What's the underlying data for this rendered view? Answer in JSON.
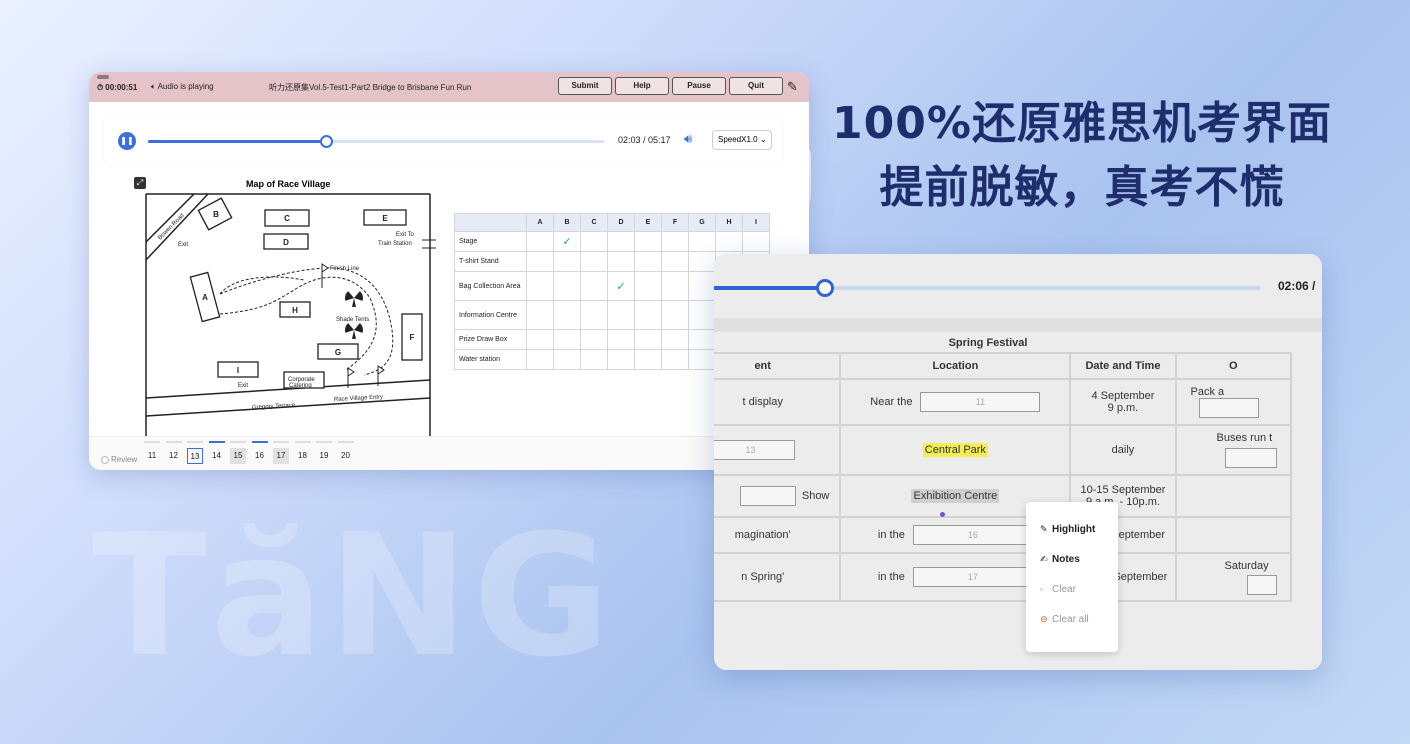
{
  "headline": {
    "line1": "100%还原雅思机考界面",
    "line2": "提前脱敏，真考不慌"
  },
  "watermark": "TăNG",
  "exam_window": {
    "timer": "00:00:51",
    "audio_status": "Audio is playing",
    "title": "听力还原集Vol.5-Test1-Part2 Bridge to Brisbane Fun Run",
    "buttons": [
      "Submit",
      "Help",
      "Pause",
      "Quit"
    ],
    "player": {
      "time": "02:03 / 05:17",
      "speed": "SpeedX1.0",
      "progress": 0.39
    },
    "map_title": "Map of Race Village",
    "map_labels": {
      "bowen_road": "Bowen Road",
      "exit_top": "Exit",
      "exit_to": "Exit To",
      "train_station": "Train Station",
      "finish_line": "Finish Line",
      "shade_tents": "Shade Tents",
      "corporate": "Corporate",
      "catering": "Catering",
      "exit_bottom": "Exit",
      "gregory": "Gregory Terrace",
      "entry": "Race Village Entry",
      "boxes": [
        "A",
        "B",
        "C",
        "D",
        "E",
        "F",
        "G",
        "H",
        "I"
      ]
    },
    "grid": {
      "columns": [
        "A",
        "B",
        "C",
        "D",
        "E",
        "F",
        "G",
        "H",
        "I"
      ],
      "rows": [
        {
          "label": "Stage",
          "check": "B"
        },
        {
          "label": "T-shirt Stand",
          "check": ""
        },
        {
          "label": "Bag Collection Area",
          "check": "D"
        },
        {
          "label": "Information Centre",
          "check": ""
        },
        {
          "label": "Prize Draw Box",
          "check": ""
        },
        {
          "label": "Water station",
          "check": ""
        }
      ]
    },
    "review_label": "Review",
    "questions": [
      "11",
      "12",
      "13",
      "14",
      "15",
      "16",
      "17",
      "18",
      "19",
      "20"
    ],
    "current_question": "13"
  },
  "festival_window": {
    "time": "02:06 /",
    "progress": 0.2,
    "caption": "Spring Festival",
    "headers": [
      "ent",
      "Location",
      "Date and Time",
      "O"
    ],
    "rows": [
      {
        "c1": "t display",
        "c2_pre": "Near the",
        "c2_box": "11",
        "c3": "4 September",
        "c3b": "9 p.m.",
        "c4": "Pack a"
      },
      {
        "c1_box": "13",
        "c2_hl": "Central Park",
        "c3": "daily",
        "c4": "Buses run t"
      },
      {
        "c1": "Show",
        "c2_sel": "Exhibition Centre",
        "c3": "10-15 September",
        "c3b": "9 a.m. - 10p.m.",
        "c4": ""
      },
      {
        "c1": "magination'",
        "c2_pre": "in the",
        "c2_box": "16",
        "c3": "11-19 September",
        "c4": ""
      },
      {
        "c1": "n Spring'",
        "c2_pre": "in the",
        "c2_box": "17",
        "c3": "17&18 September",
        "c4": "Saturday"
      }
    ],
    "menu": [
      "Highlight",
      "Notes",
      "Clear",
      "Clear all"
    ]
  }
}
